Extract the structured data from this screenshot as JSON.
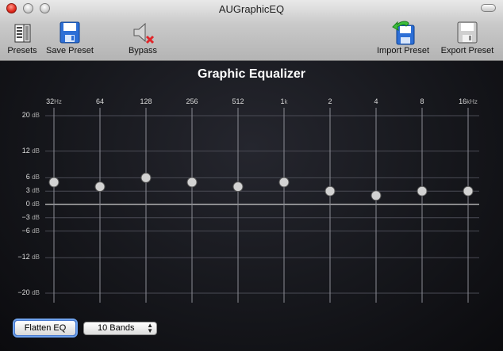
{
  "window": {
    "title": "AUGraphicEQ"
  },
  "toolbar": {
    "presets_label": "Presets",
    "save_preset_label": "Save Preset",
    "bypass_label": "Bypass",
    "import_preset_label": "Import Preset",
    "export_preset_label": "Export Preset"
  },
  "eq": {
    "title": "Graphic Equalizer",
    "bands": [
      {
        "label": "32",
        "unit": "Hz",
        "gain_db": 5
      },
      {
        "label": "64",
        "unit": "",
        "gain_db": 4
      },
      {
        "label": "128",
        "unit": "",
        "gain_db": 6
      },
      {
        "label": "256",
        "unit": "",
        "gain_db": 5
      },
      {
        "label": "512",
        "unit": "",
        "gain_db": 4
      },
      {
        "label": "1",
        "unit": "k",
        "gain_db": 5
      },
      {
        "label": "2",
        "unit": "",
        "gain_db": 3
      },
      {
        "label": "4",
        "unit": "",
        "gain_db": 2
      },
      {
        "label": "8",
        "unit": "",
        "gain_db": 3
      },
      {
        "label": "16",
        "unit": "kHz",
        "gain_db": 3
      }
    ],
    "db_scale": [
      {
        "value": 20,
        "num": "20",
        "unit": "dB"
      },
      {
        "value": 12,
        "num": "12",
        "unit": "dB"
      },
      {
        "value": 6,
        "num": "6",
        "unit": "dB"
      },
      {
        "value": 3,
        "num": "3",
        "unit": "dB"
      },
      {
        "value": 0,
        "num": "0",
        "unit": "dB"
      },
      {
        "value": -3,
        "num": "−3",
        "unit": "dB"
      },
      {
        "value": -6,
        "num": "−6",
        "unit": "dB"
      },
      {
        "value": -12,
        "num": "−12",
        "unit": "dB"
      },
      {
        "value": -20,
        "num": "−20",
        "unit": "dB"
      }
    ]
  },
  "controls": {
    "flatten_label": "Flatten EQ",
    "bands_select_value": "10 Bands"
  }
}
